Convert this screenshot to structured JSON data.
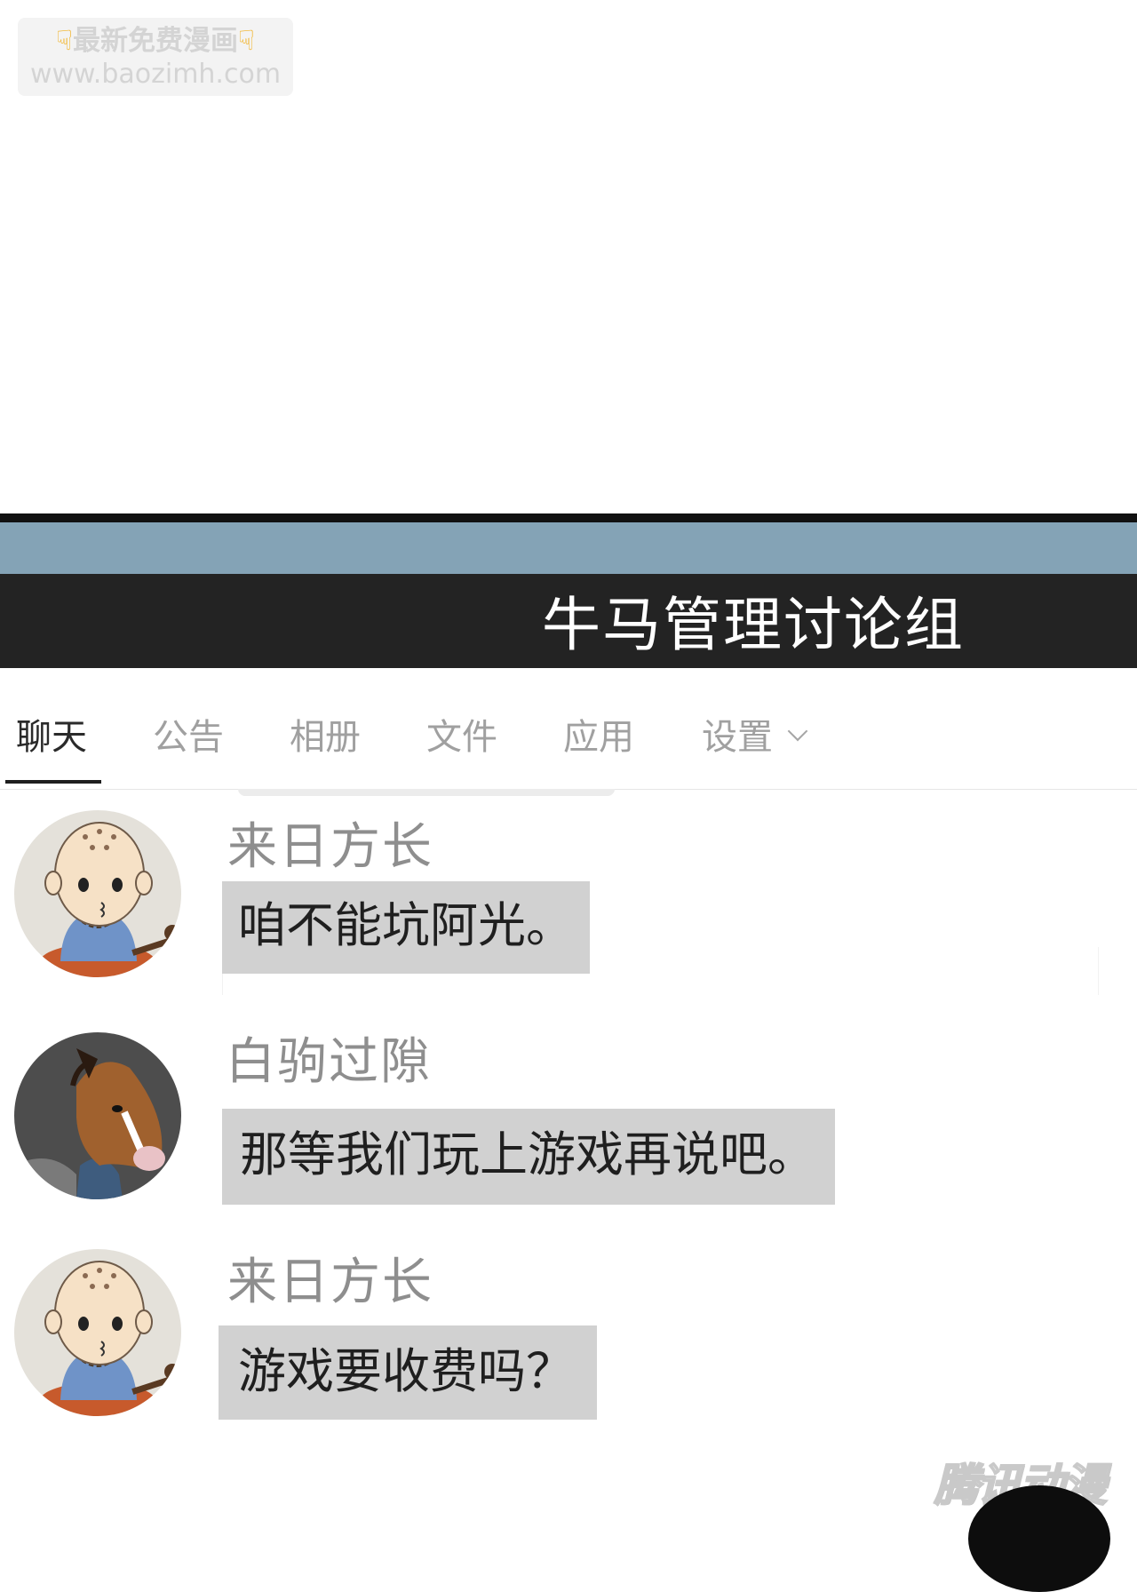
{
  "watermark": {
    "line1": "最新免费漫画",
    "line2": "www.baozimh.com",
    "hand_icon": "pointing-down-hand"
  },
  "header": {
    "title": "牛马管理讨论组",
    "colors": {
      "blue_band": "#84a3b6",
      "title_band": "#232323"
    }
  },
  "tabs": [
    {
      "label": "聊天",
      "active": true
    },
    {
      "label": "公告",
      "active": false
    },
    {
      "label": "相册",
      "active": false
    },
    {
      "label": "文件",
      "active": false
    },
    {
      "label": "应用",
      "active": false
    },
    {
      "label": "设置",
      "active": false,
      "icon": "chevron-down-icon"
    }
  ],
  "messages": [
    {
      "sender": "来日方长",
      "text": "咱不能坑阿光。",
      "avatar": "monk-avatar"
    },
    {
      "sender": "白驹过隙",
      "text": "那等我们玩上游戏再说吧。",
      "avatar": "horse-avatar"
    },
    {
      "sender": "来日方长",
      "text": "游戏要收费吗？",
      "avatar": "monk-avatar"
    }
  ],
  "brand": {
    "text": "腾讯动漫"
  }
}
